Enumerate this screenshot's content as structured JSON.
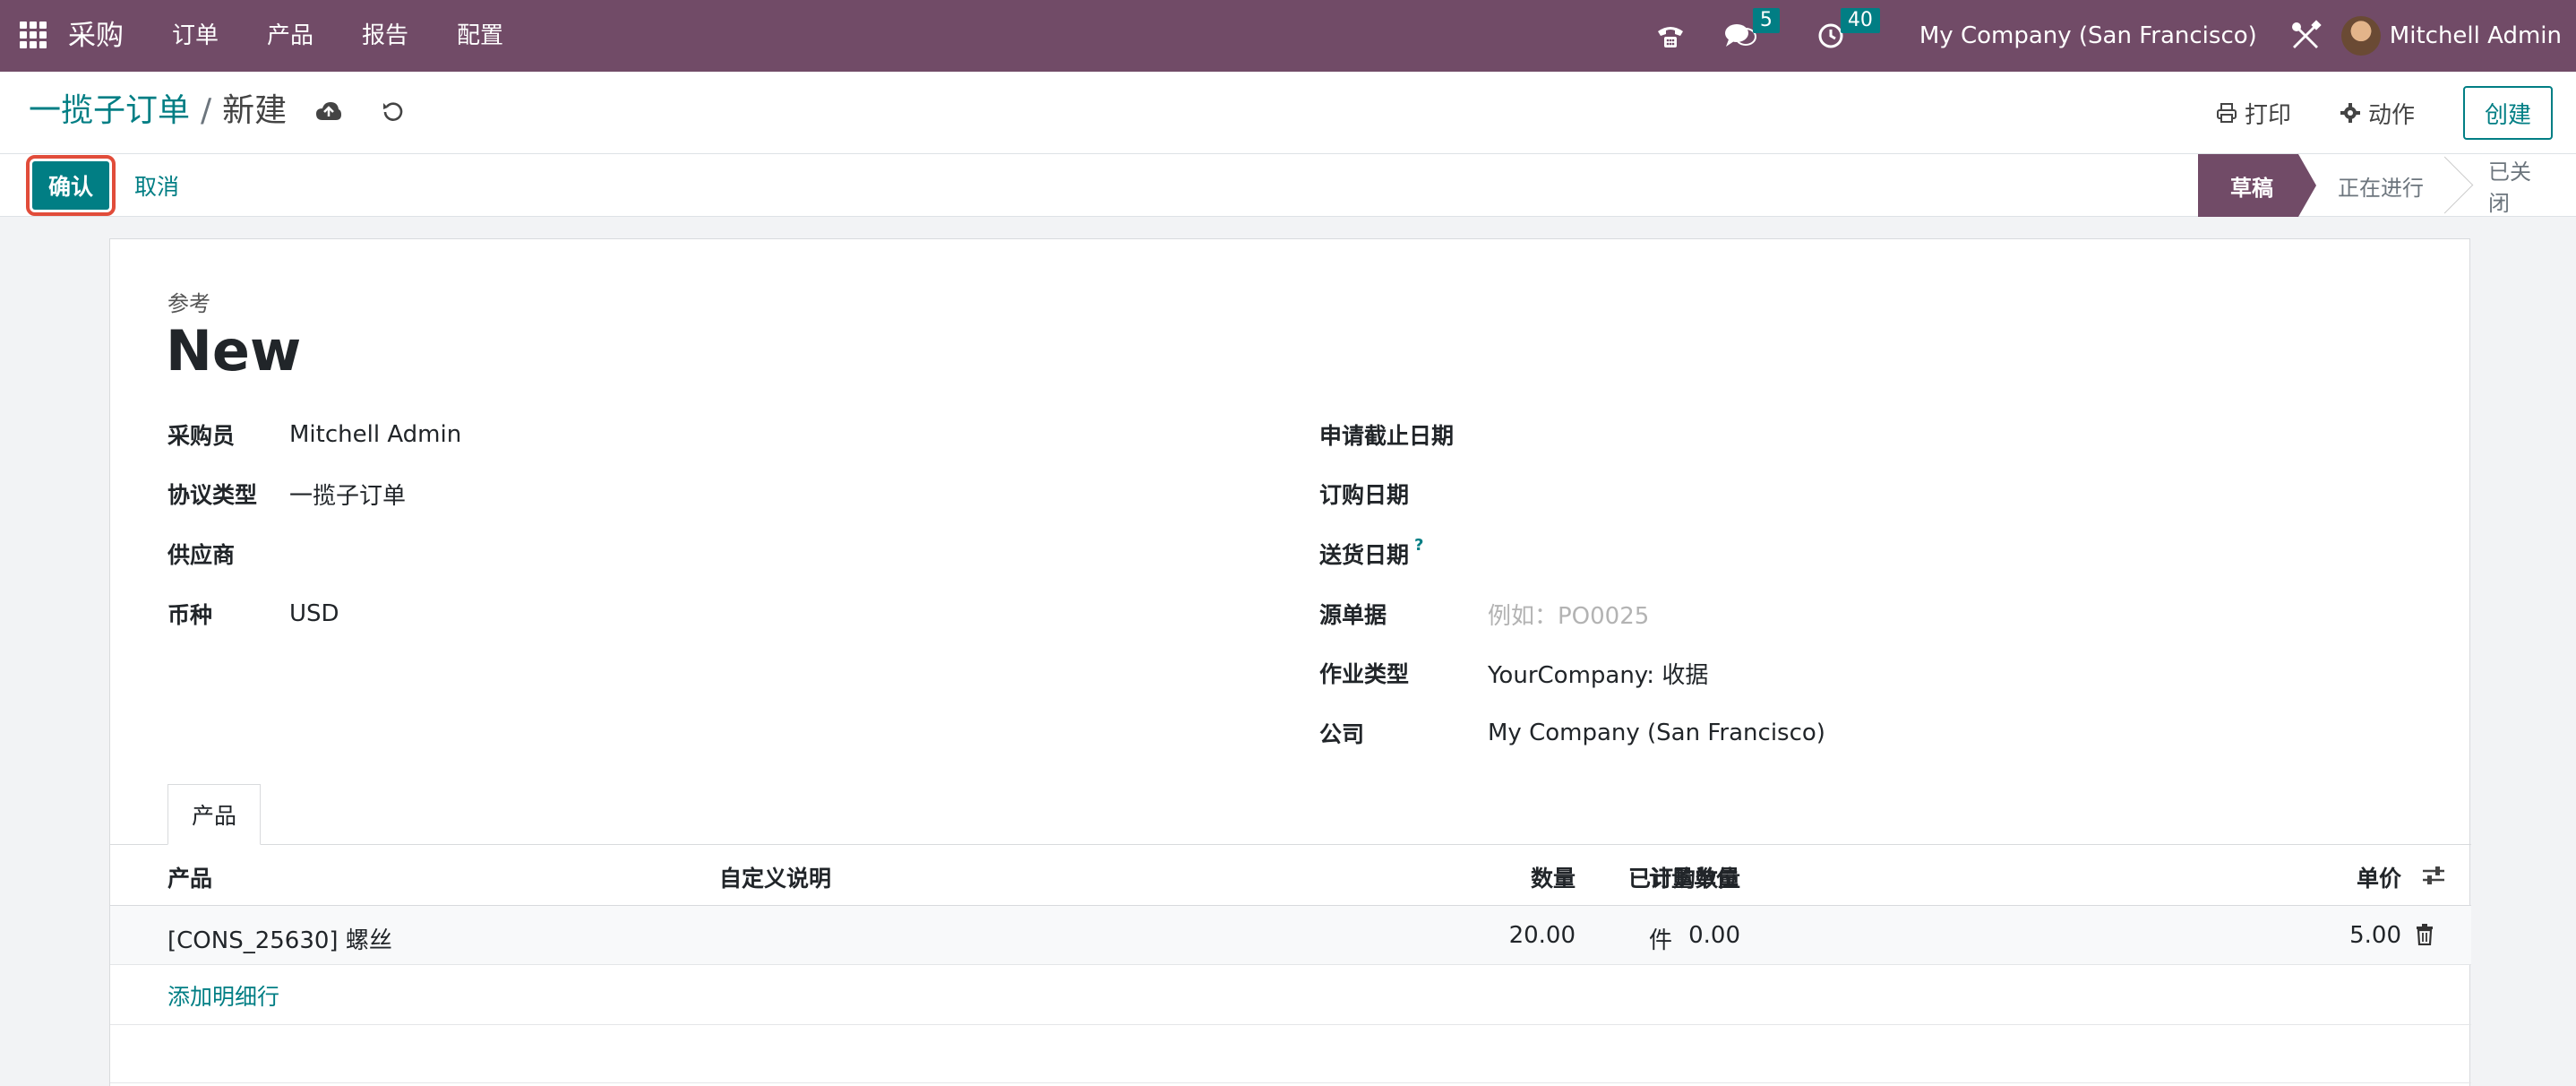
{
  "navbar": {
    "app_name": "采购",
    "menu": [
      "订单",
      "产品",
      "报告",
      "配置"
    ],
    "messages_count": "5",
    "activities_count": "40",
    "company": "My Company (San Francisco)",
    "user": "Mitchell Admin"
  },
  "control_panel": {
    "breadcrumb_parent": "一揽子订单",
    "breadcrumb_sep": "/",
    "breadcrumb_current": "新建",
    "print_label": "打印",
    "action_label": "动作",
    "create_label": "创建"
  },
  "status_bar": {
    "confirm_label": "确认",
    "cancel_label": "取消",
    "stages": [
      "草稿",
      "正在进行",
      "已关闭"
    ]
  },
  "form": {
    "reference_label": "参考",
    "reference_value": "New",
    "left_fields": [
      {
        "label": "采购员",
        "value": "Mitchell Admin"
      },
      {
        "label": "协议类型",
        "value": "一揽子订单"
      },
      {
        "label": "供应商",
        "value": ""
      },
      {
        "label": "币种",
        "value": "USD"
      }
    ],
    "right_fields": [
      {
        "label": "申请截止日期",
        "value": ""
      },
      {
        "label": "订购日期",
        "value": ""
      },
      {
        "label": "送货日期",
        "value": "",
        "help": "?"
      },
      {
        "label": "源单据",
        "value": "",
        "placeholder": "例如：PO0025"
      },
      {
        "label": "作业类型",
        "value": "YourCompany: 收据"
      },
      {
        "label": "公司",
        "value": "My Company (San Francisco)"
      }
    ]
  },
  "tabs": [
    "产品"
  ],
  "table": {
    "headers": {
      "product": "产品",
      "description": "自定义说明",
      "qty": "数量",
      "ordered_qty": "已订购数量",
      "uom": "计量单位",
      "price": "单价"
    },
    "rows": [
      {
        "product": "[CONS_25630] 螺丝",
        "description": "",
        "qty": "20.00",
        "ordered_qty": "0.00",
        "uom": "件",
        "price": "5.00"
      }
    ],
    "add_line_label": "添加明细行"
  },
  "colors": {
    "brand": "#714b67",
    "accent": "#017e84",
    "highlight": "#e14c3a"
  }
}
